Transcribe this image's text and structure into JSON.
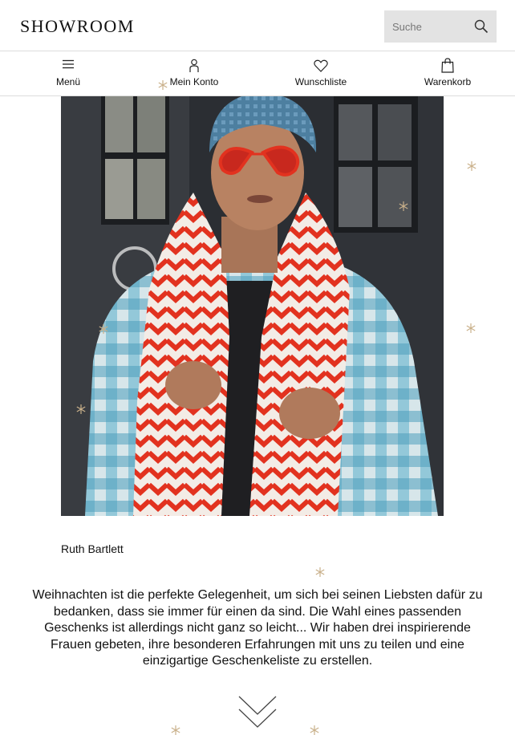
{
  "header": {
    "logo_text": "SHOWROOM",
    "search_placeholder": "Suche",
    "search_icon": "search-icon"
  },
  "nav": {
    "items": [
      {
        "label": "Menü",
        "icon": "hamburger-menu-icon"
      },
      {
        "label": "Mein Konto",
        "icon": "user-icon"
      },
      {
        "label": "Wunschliste",
        "icon": "heart-icon"
      },
      {
        "label": "Warenkorb",
        "icon": "shopping-bag-icon"
      }
    ]
  },
  "article": {
    "image_caption": "Ruth Bartlett",
    "intro_text": "Weihnachten ist die perfekte Gelegenheit, um sich bei seinen Liebsten dafür zu bedanken, dass sie immer für einen da sind. Die Wahl eines passenden Geschenks ist allerdings nicht ganz so leicht... Wir haben drei inspirierende Frauen gebeten, ihre besonderen Erfahrungen mit uns zu teilen und eine einzigartige Geschenkeliste zu erstellen."
  },
  "colors": {
    "accent_snowflake": "#c9b08a",
    "divider": "#dcdcdc",
    "search_bg": "#e3e3e3",
    "scarf_red": "#e2321f",
    "coat_blue": "#6fb8cf"
  },
  "icons": {
    "scroll_down": "double-chevron-down-icon",
    "decoration": "snowflake-icon"
  }
}
